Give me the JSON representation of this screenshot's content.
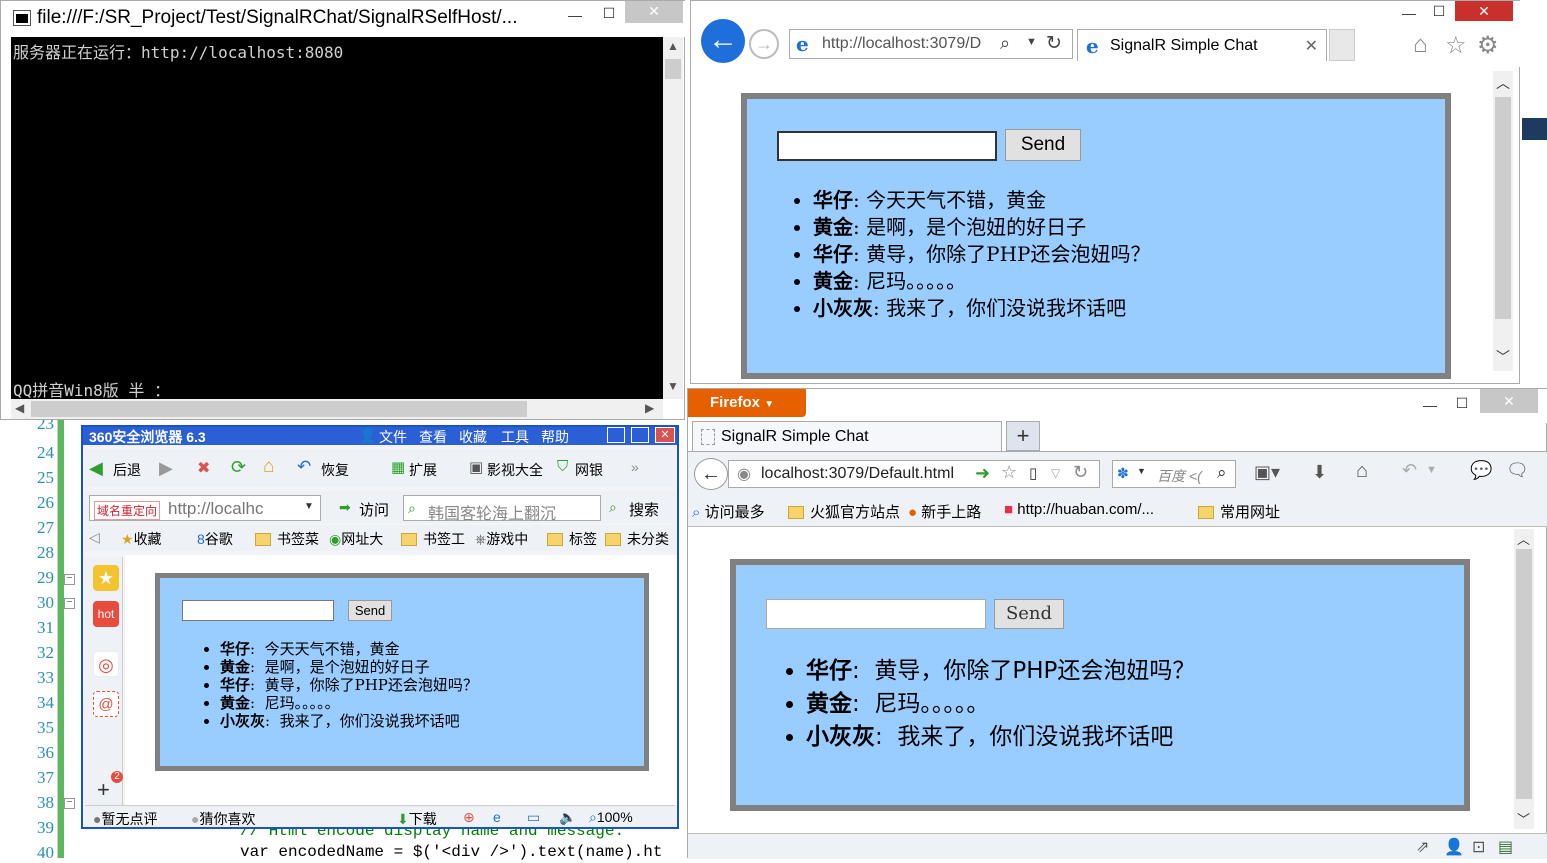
{
  "console": {
    "title": "file:///F:/SR_Project/Test/SignalRChat/SignalRSelfHost/...",
    "line1": "服务器正在运行：http://localhost:8080",
    "line2": "QQ拼音Win8版 半 ："
  },
  "editor": {
    "line_numbers": [
      "23",
      "24",
      "25",
      "26",
      "27",
      "28",
      "29",
      "30",
      "31",
      "32",
      "33",
      "34",
      "35",
      "36",
      "37",
      "38",
      "39",
      "40"
    ],
    "code_comment": "// Html encode display name and message.",
    "code_line": "var encodedName = $('<div />').text(name).ht"
  },
  "ie": {
    "address": "http://localhost:3079/D",
    "tab_title": "SignalR Simple Chat",
    "send_label": "Send",
    "messages": [
      {
        "name": "华仔",
        "text": "今天天气不错，黄金"
      },
      {
        "name": "黄金",
        "text": "是啊，是个泡妞的好日子"
      },
      {
        "name": "华仔",
        "text": "黄导，你除了PHP还会泡妞吗？"
      },
      {
        "name": "黄金",
        "text": "尼玛。。。。。"
      },
      {
        "name": "小灰灰",
        "text": "我来了，你们没说我坏话吧"
      }
    ]
  },
  "b360": {
    "title": "360安全浏览器 6.3",
    "menu": [
      "文件",
      "查看",
      "收藏",
      "工具",
      "帮助"
    ],
    "toolbar": {
      "back": "后退",
      "restore": "恢复",
      "extend": "扩展",
      "video": "影视大全",
      "bank": "网银"
    },
    "redirect_label": "域名重定向",
    "address": "http://localhc",
    "visit": "访问",
    "search_placeholder": "韩国客轮海上翻沉",
    "search": "搜索",
    "bookmarks": [
      "收藏",
      "谷歌",
      "书签菜",
      "网址大",
      "书签工",
      "游戏中",
      "标签",
      "未分类"
    ],
    "side_badge_hot": "hot",
    "side_badge_count": "2",
    "send_label": "Send",
    "messages": [
      {
        "name": "华仔",
        "text": "今天天气不错，黄金"
      },
      {
        "name": "黄金",
        "text": "是啊，是个泡妞的好日子"
      },
      {
        "name": "华仔",
        "text": "黄导，你除了PHP还会泡妞吗？"
      },
      {
        "name": "黄金",
        "text": "尼玛。。。。。"
      },
      {
        "name": "小灰灰",
        "text": "我来了，你们没说我坏话吧"
      }
    ],
    "status": {
      "rating": "暂无点评",
      "guess": "猜你喜欢",
      "download": "下载",
      "zoom": "100%"
    }
  },
  "firefox": {
    "menu_button": "Firefox",
    "tab_title": "SignalR Simple Chat",
    "url": "localhost:3079/Default.html",
    "search_placeholder": "百度 <(",
    "bookmarks": [
      "访问最多",
      "火狐官方站点",
      "新手上路",
      "http://huaban.com/...",
      "常用网址"
    ],
    "send_label": "Send",
    "messages": [
      {
        "name": "华仔",
        "text": "黄导，你除了PHP还会泡妞吗？"
      },
      {
        "name": "黄金",
        "text": "尼玛。。。。。"
      },
      {
        "name": "小灰灰",
        "text": "我来了，你们没说我坏话吧"
      }
    ]
  },
  "colors": {
    "chat_bg": "#99ccff",
    "chat_border": "#808080",
    "ie_blue": "#1e6fd9",
    "firefox_orange": "#e66000"
  }
}
